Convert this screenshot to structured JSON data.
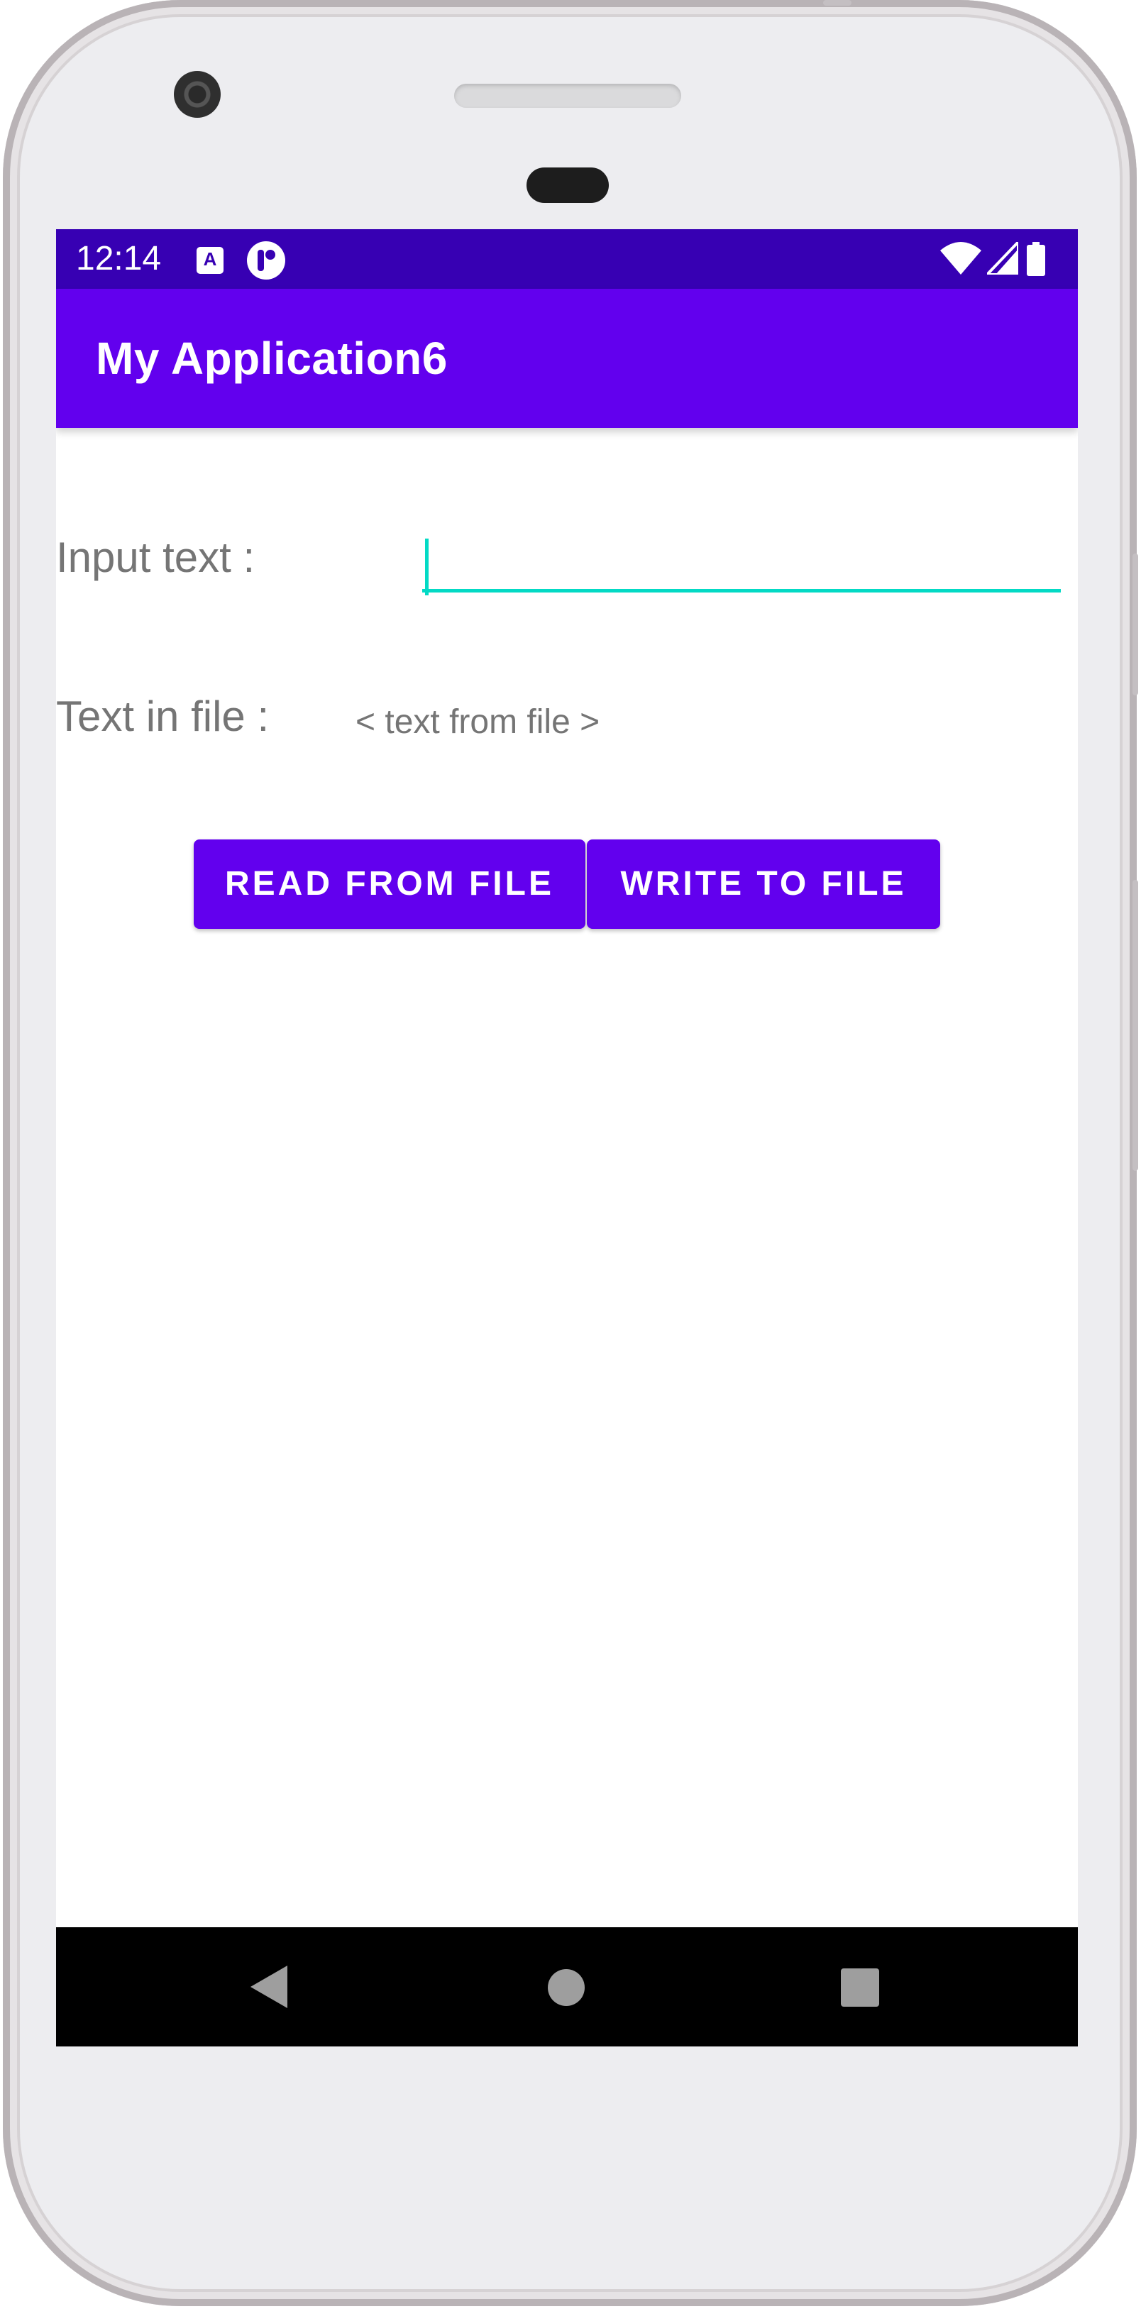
{
  "status_bar": {
    "time": "12:14",
    "icons": [
      "a-notification-icon",
      "app-notification-icon",
      "wifi-icon",
      "signal-icon",
      "battery-icon"
    ]
  },
  "app_bar": {
    "title": "My Application6"
  },
  "form": {
    "input_label": "Input text :",
    "input_value": "",
    "file_label": "Text in file :",
    "file_text": "< text from file >"
  },
  "buttons": {
    "read": "READ FROM FILE",
    "write": "WRITE TO FILE"
  },
  "nav_bar": {
    "icons": [
      "back-icon",
      "home-icon",
      "recents-icon"
    ]
  },
  "colors": {
    "primary": "#6200ee",
    "primary_dark": "#3700b3",
    "accent": "#03dac5",
    "label_text": "#757575"
  }
}
